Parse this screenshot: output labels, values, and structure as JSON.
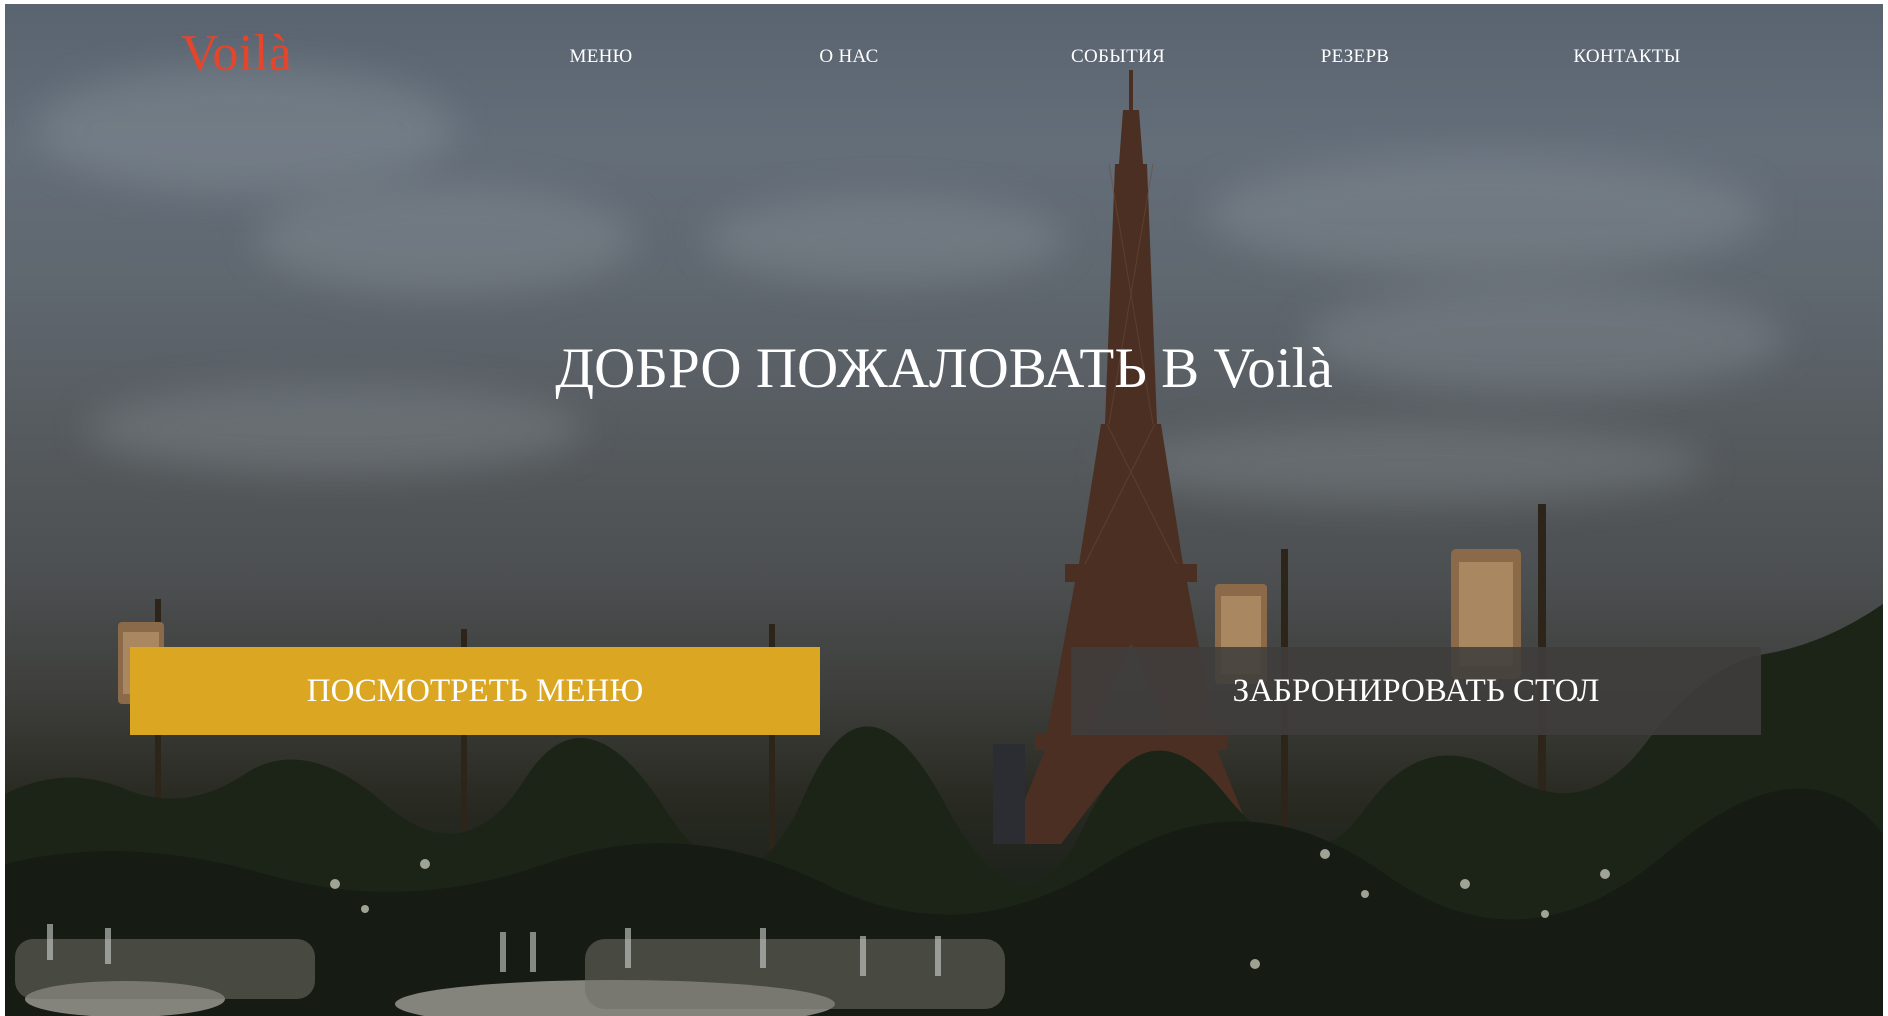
{
  "brand": {
    "logo_text": "Voilà",
    "accent_color": "#e4452b"
  },
  "nav": {
    "items": [
      {
        "label": "МЕНЮ"
      },
      {
        "label": "О НАС"
      },
      {
        "label": "СОБЫТИЯ"
      },
      {
        "label": "РЕЗЕРВ"
      },
      {
        "label": "КОНТАКТЫ"
      }
    ]
  },
  "hero": {
    "title": "ДОБРО ПОЖАЛОВАТЬ В Voilà",
    "background": "eiffel-tower-terrace-photo"
  },
  "actions": {
    "view_menu_label": "ПОСМОТРЕТЬ МЕНЮ",
    "view_menu_color": "#dba723",
    "reserve_label": "ЗАБРОНИРОВАТЬ СТОЛ",
    "reserve_color": "#403e3c"
  }
}
